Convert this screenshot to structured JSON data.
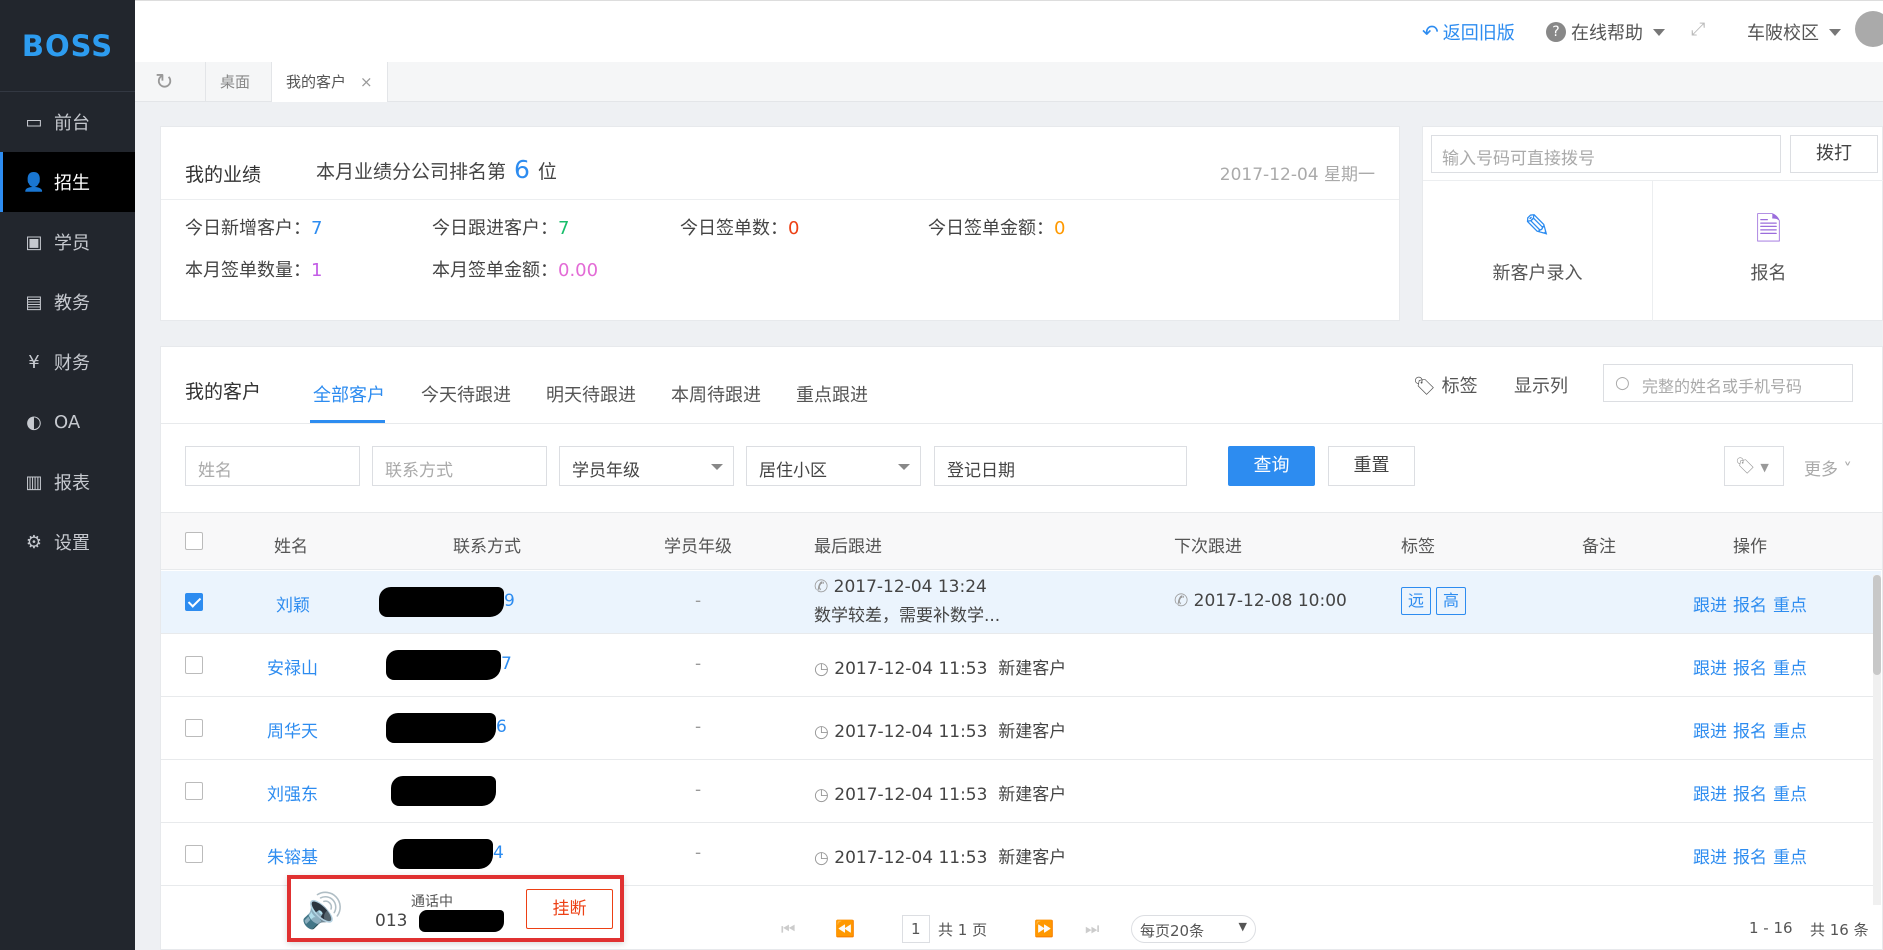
{
  "app": {
    "logo": "BOSS"
  },
  "sidebar": {
    "items": [
      {
        "label": "前台",
        "icon": "calendar-icon"
      },
      {
        "label": "招生",
        "icon": "add-user-icon",
        "active": true
      },
      {
        "label": "学员",
        "icon": "id-card-icon"
      },
      {
        "label": "教务",
        "icon": "book-icon"
      },
      {
        "label": "财务",
        "icon": "yen-icon"
      },
      {
        "label": "OA",
        "icon": "toggle-icon"
      },
      {
        "label": "报表",
        "icon": "bar-chart-icon"
      },
      {
        "label": "设置",
        "icon": "gear-icon"
      }
    ]
  },
  "header": {
    "back_label": "返回旧版",
    "help_label": "在线帮助",
    "campus_label": "车陂校区"
  },
  "tabs": {
    "desktop": "桌面",
    "current": "我的客户",
    "close": "×"
  },
  "performance": {
    "title": "我的业绩",
    "rank_prefix": "本月业绩分公司排名第",
    "rank_value": "6",
    "rank_suffix": "位",
    "date": "2017-12-04 星期一",
    "stats": {
      "new_today_label": "今日新增客户：",
      "new_today": "7",
      "follow_today_label": "今日跟进客户：",
      "follow_today": "7",
      "signed_today_label": "今日签单数：",
      "signed_today": "0",
      "amount_today_label": "今日签单金额：",
      "amount_today": "0",
      "signed_month_label": "本月签单数量：",
      "signed_month": "1",
      "amount_month_label": "本月签单金额：",
      "amount_month": "0.00"
    }
  },
  "dial": {
    "placeholder": "输入号码可直接拨号",
    "button": "拨打",
    "action_new": "新客户录入",
    "action_enroll": "报名"
  },
  "customers": {
    "title": "我的客户",
    "tabs": [
      "全部客户",
      "今天待跟进",
      "明天待跟进",
      "本周待跟进",
      "重点跟进"
    ],
    "tools": {
      "tag": "标签",
      "columns": "显示列",
      "search_placeholder": "完整的姓名或手机号码"
    },
    "filters": {
      "name_placeholder": "姓名",
      "contact_placeholder": "联系方式",
      "grade": "学员年级",
      "community": "居住小区",
      "date": "登记日期",
      "query": "查询",
      "reset": "重置",
      "more": "更多"
    },
    "columns": [
      "姓名",
      "联系方式",
      "学员年级",
      "最后跟进",
      "下次跟进",
      "标签",
      "备注",
      "操作"
    ],
    "rows": [
      {
        "name": "刘颖",
        "phone_tail": "9",
        "grade": "-",
        "last_time": "2017-12-04 13:24",
        "last_note": "数学较差，需要补数学...",
        "next": "2017-12-08 10:00",
        "tags": [
          "远",
          "高"
        ],
        "checked": true
      },
      {
        "name": "安禄山",
        "phone_tail": "7",
        "grade": "-",
        "last_time": "2017-12-04 11:53",
        "last_note": "新建客户",
        "next": "",
        "tags": [],
        "checked": false
      },
      {
        "name": "周华天",
        "phone_tail": "6",
        "grade": "-",
        "last_time": "2017-12-04 11:53",
        "last_note": "新建客户",
        "next": "",
        "tags": [],
        "checked": false
      },
      {
        "name": "刘强东",
        "phone_tail": "",
        "grade": "-",
        "last_time": "2017-12-04 11:53",
        "last_note": "新建客户",
        "next": "",
        "tags": [],
        "checked": false
      },
      {
        "name": "朱镕基",
        "phone_tail": "4",
        "grade": "-",
        "last_time": "2017-12-04 11:53",
        "last_note": "新建客户",
        "next": "",
        "tags": [],
        "checked": false
      }
    ],
    "ops": [
      "跟进",
      "报名",
      "重点"
    ],
    "pager": {
      "page": "1",
      "total_pages": "共 1 页",
      "per_page": "每页20条",
      "range": "1 - 16",
      "total": "共 16 条"
    }
  },
  "call": {
    "status": "通话中",
    "number_prefix": "013",
    "hangup": "挂断"
  }
}
